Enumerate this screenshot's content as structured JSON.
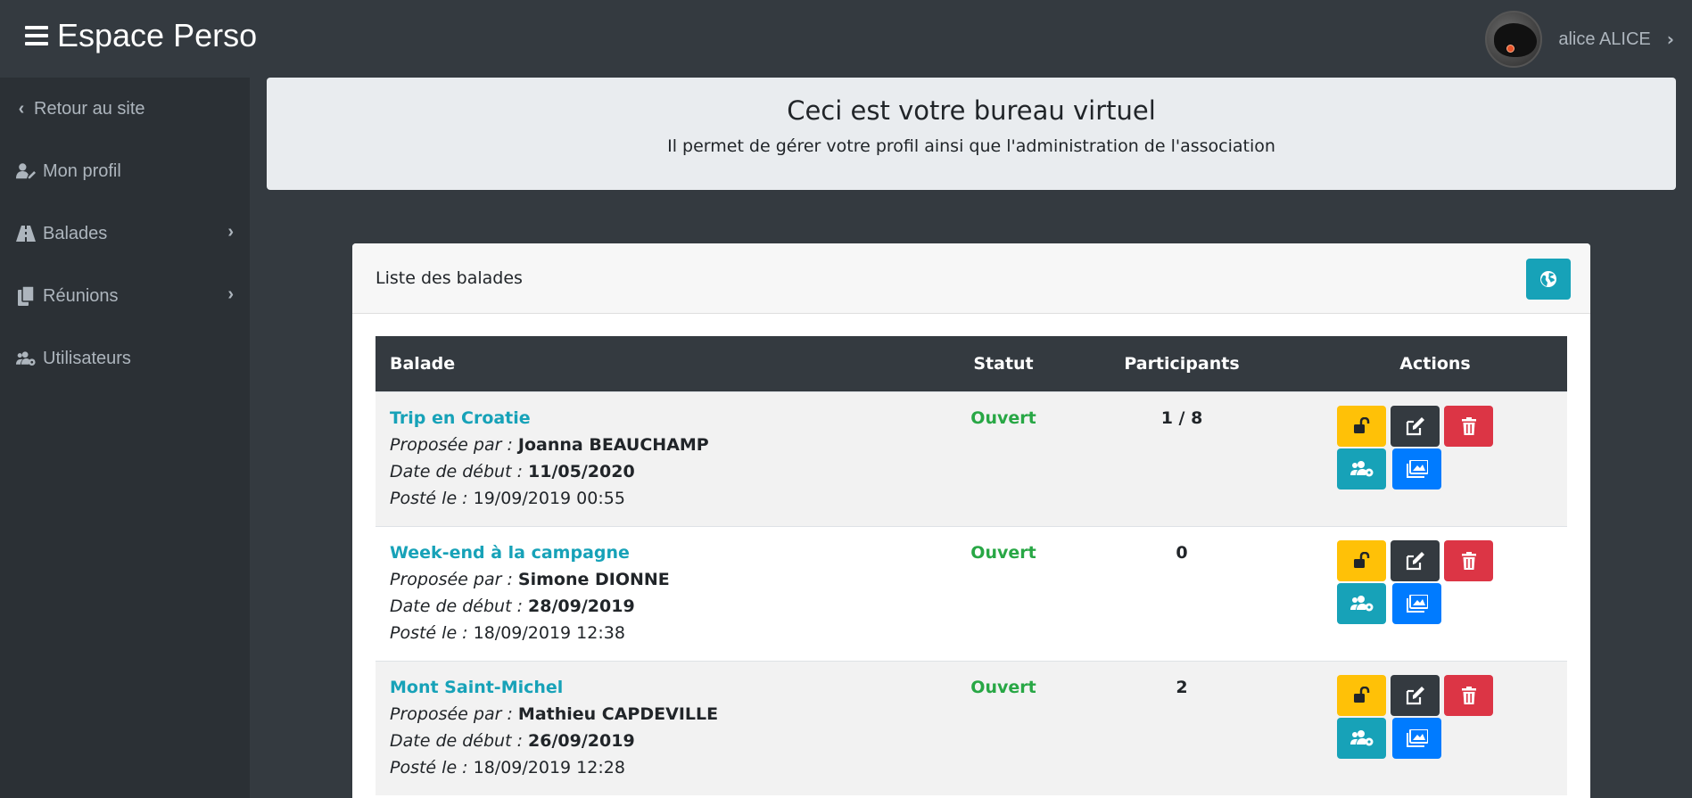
{
  "app": {
    "brand": "Espace Perso",
    "user_name": "alice ALICE"
  },
  "sidebar": {
    "items": [
      {
        "label": "Retour au site",
        "icon": "chevron-left-icon"
      },
      {
        "label": "Mon profil",
        "icon": "user-edit-icon"
      },
      {
        "label": "Balades",
        "icon": "road-icon",
        "has_submenu": true
      },
      {
        "label": "Réunions",
        "icon": "copy-icon",
        "has_submenu": true
      },
      {
        "label": "Utilisateurs",
        "icon": "users-cog-icon"
      }
    ]
  },
  "jumbotron": {
    "title": "Ceci est votre bureau virtuel",
    "subtitle": "Il permet de gérer votre profil ainsi que l'administration de l'association"
  },
  "card": {
    "title": "Liste des balades",
    "header_button_icon": "globe-icon"
  },
  "table": {
    "headers": {
      "balade": "Balade",
      "statut": "Statut",
      "participants": "Participants",
      "actions": "Actions"
    },
    "label_proposed_by": "Proposée par :",
    "label_start_date": "Date de début :",
    "label_posted": "Posté le :",
    "rows": [
      {
        "title": "Trip en Croatie",
        "proposed_by": "Joanna BEAUCHAMP",
        "start_date": "11/05/2020",
        "posted": "19/09/2019 00:55",
        "status": "Ouvert",
        "participants": "1 / 8"
      },
      {
        "title": "Week-end à la campagne",
        "proposed_by": "Simone DIONNE",
        "start_date": "28/09/2019",
        "posted": "18/09/2019 12:38",
        "status": "Ouvert",
        "participants": "0"
      },
      {
        "title": "Mont Saint-Michel",
        "proposed_by": "Mathieu CAPDEVILLE",
        "start_date": "26/09/2019",
        "posted": "18/09/2019 12:28",
        "status": "Ouvert",
        "participants": "2"
      }
    ]
  },
  "colors": {
    "topbar": "#343a40",
    "sidebar": "#2b3035",
    "accent_info": "#17a2b8",
    "status_open": "#28a745",
    "warning": "#ffc107",
    "danger": "#dc3545",
    "primary": "#007bff"
  }
}
